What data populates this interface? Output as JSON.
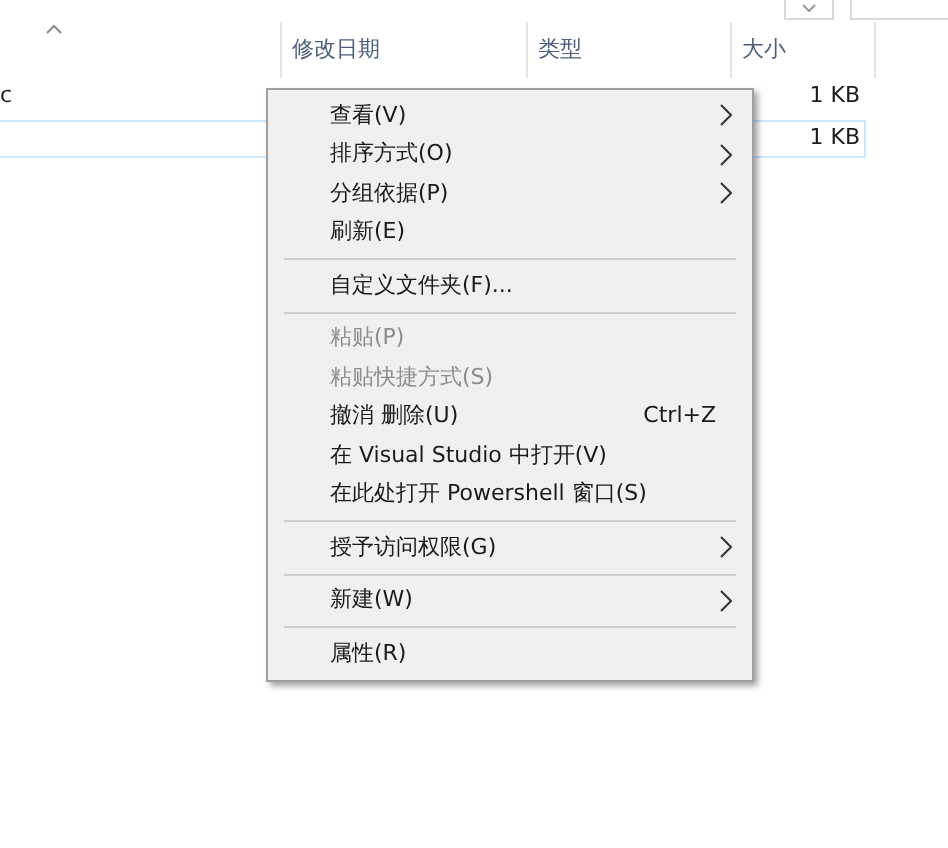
{
  "columns": [
    {
      "label": "修改日期"
    },
    {
      "label": "类型"
    },
    {
      "label": "大小"
    }
  ],
  "files": [
    {
      "name": "c",
      "size": "1 KB",
      "selected": false
    },
    {
      "size": "1 KB",
      "selected": true
    }
  ],
  "context_menu": {
    "groups": [
      [
        {
          "label": "查看(V)",
          "submenu": true,
          "disabled": false
        },
        {
          "label": "排序方式(O)",
          "submenu": true,
          "disabled": false
        },
        {
          "label": "分组依据(P)",
          "submenu": true,
          "disabled": false
        },
        {
          "label": "刷新(E)",
          "submenu": false,
          "disabled": false
        }
      ],
      [
        {
          "label": "自定义文件夹(F)...",
          "submenu": false,
          "disabled": false
        }
      ],
      [
        {
          "label": "粘贴(P)",
          "submenu": false,
          "disabled": true
        },
        {
          "label": "粘贴快捷方式(S)",
          "submenu": false,
          "disabled": true
        },
        {
          "label": "撤消 删除(U)",
          "submenu": false,
          "disabled": false,
          "shortcut": "Ctrl+Z"
        },
        {
          "label": "在 Visual Studio 中打开(V)",
          "submenu": false,
          "disabled": false
        },
        {
          "label": "在此处打开 Powershell 窗口(S)",
          "submenu": false,
          "disabled": false
        }
      ],
      [
        {
          "label": "授予访问权限(G)",
          "submenu": true,
          "disabled": false
        }
      ],
      [
        {
          "label": "新建(W)",
          "submenu": true,
          "disabled": false
        }
      ],
      [
        {
          "label": "属性(R)",
          "submenu": false,
          "disabled": false
        }
      ]
    ]
  }
}
